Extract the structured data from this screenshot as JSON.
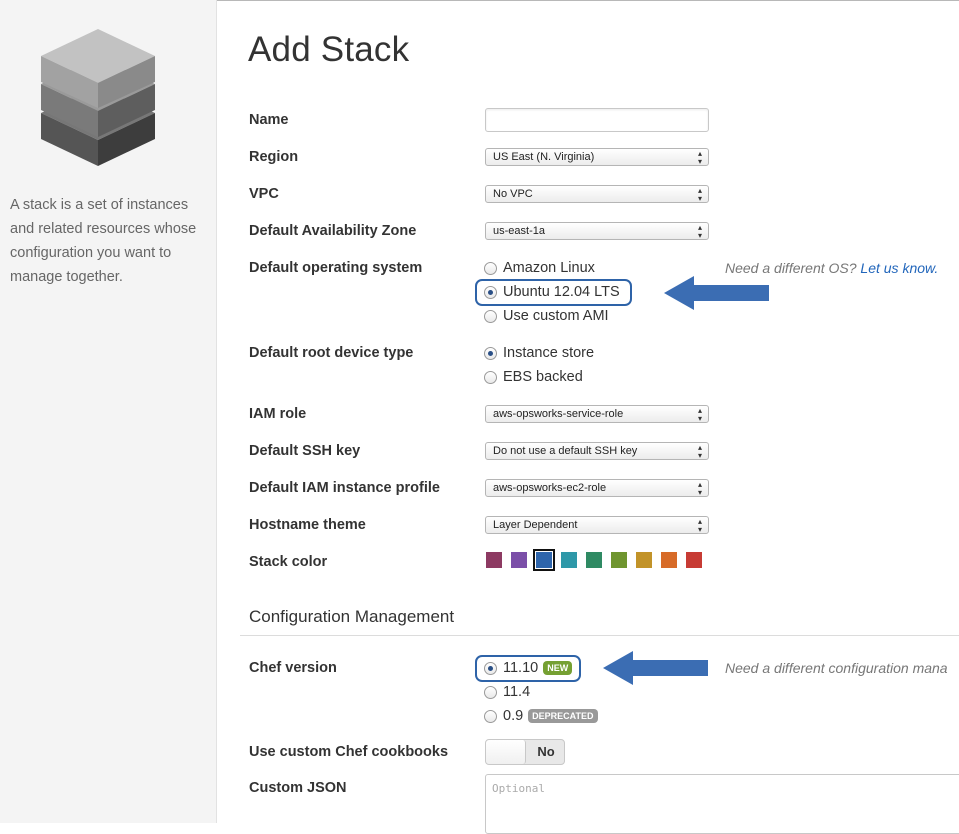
{
  "sidebar": {
    "description": "A stack is a set of instances and related resources whose configuration you want to manage together."
  },
  "page": {
    "title": "Add Stack"
  },
  "form": {
    "name": {
      "label": "Name",
      "value": ""
    },
    "region": {
      "label": "Region",
      "value": "US East (N. Virginia)"
    },
    "vpc": {
      "label": "VPC",
      "value": "No VPC"
    },
    "availability_zone": {
      "label": "Default Availability Zone",
      "value": "us-east-1a"
    },
    "os": {
      "label": "Default operating system",
      "options": [
        "Amazon Linux",
        "Ubuntu 12.04 LTS",
        "Use custom AMI"
      ],
      "selected": "Ubuntu 12.04 LTS",
      "hint": "Need a different OS?",
      "hint_link": "Let us know."
    },
    "root_device": {
      "label": "Default root device type",
      "options": [
        "Instance store",
        "EBS backed"
      ],
      "selected": "Instance store"
    },
    "iam_role": {
      "label": "IAM role",
      "value": "aws-opsworks-service-role"
    },
    "ssh_key": {
      "label": "Default SSH key",
      "value": "Do not use a default SSH key"
    },
    "instance_profile": {
      "label": "Default IAM instance profile",
      "value": "aws-opsworks-ec2-role"
    },
    "hostname_theme": {
      "label": "Hostname theme",
      "value": "Layer Dependent"
    },
    "stack_color": {
      "label": "Stack color",
      "colors": [
        "#8d3a62",
        "#7b4fa8",
        "#2e65ac",
        "#2e98a8",
        "#2f8a63",
        "#6f952f",
        "#c29329",
        "#d76b28",
        "#c73b34"
      ],
      "selected_index": 2
    }
  },
  "config": {
    "section_title": "Configuration Management",
    "chef_version": {
      "label": "Chef version",
      "options": [
        "11.10",
        "11.4",
        "0.9"
      ],
      "selected": "11.10",
      "badge_new": "NEW",
      "badge_deprecated": "DEPRECATED",
      "hint": "Need a different configuration mana"
    },
    "custom_cookbooks": {
      "label": "Use custom Chef cookbooks",
      "value": "No"
    },
    "custom_json": {
      "label": "Custom JSON",
      "placeholder": "Optional"
    }
  },
  "colors": {
    "accent": "#2e63a8",
    "link": "#2266bb"
  }
}
